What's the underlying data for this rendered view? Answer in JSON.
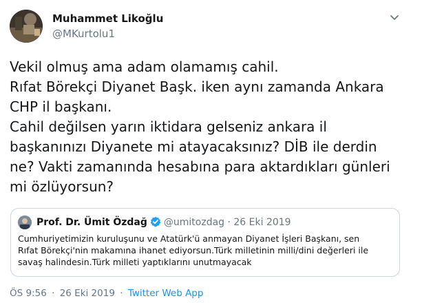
{
  "author": {
    "name": "Muhammet Likoğlu",
    "handle": "@MKurtolu1"
  },
  "tweet": {
    "lines": [
      "Vekil olmuş ama adam olamamış cahil.",
      "Rıfat Börekçi Diyanet Başk. iken aynı zamanda Ankara",
      "CHP il başkanı.",
      "Cahil değilsen yarın iktidara gelseniz ankara il",
      "başkanınızı Diyanete mi atayacaksınız? DİB ile derdin",
      "ne? Vakti zamanında hesabına para aktardıkları günleri",
      "mi özlüyorsun?"
    ]
  },
  "quoted": {
    "name": "Prof. Dr. Ümit Özdağ",
    "handle": "@umitozdag",
    "date": "· 26 Eki 2019",
    "verified_icon": "verified-badge-icon",
    "lines": [
      "Cumhuriyetimizin kuruluşunu ve Atatürk'ü anmayan Diyanet İşleri Başkanı, sen",
      "Rıfat Börekçi'nin makamına ihanet ediyorsun.Türk milletinin milli/dini değerleri ile",
      "savaş halindesin.Türk milleti yaptıklarını unutmayacak"
    ]
  },
  "footer": {
    "time": "ÖS 9:56",
    "separator": "·",
    "date": "26 Eki 2019",
    "source": "Twitter Web App"
  },
  "colors": {
    "accent": "#1b95e0",
    "secondary_text": "#657786",
    "border": "#ccd6dd",
    "verified": "#1da1f2"
  }
}
